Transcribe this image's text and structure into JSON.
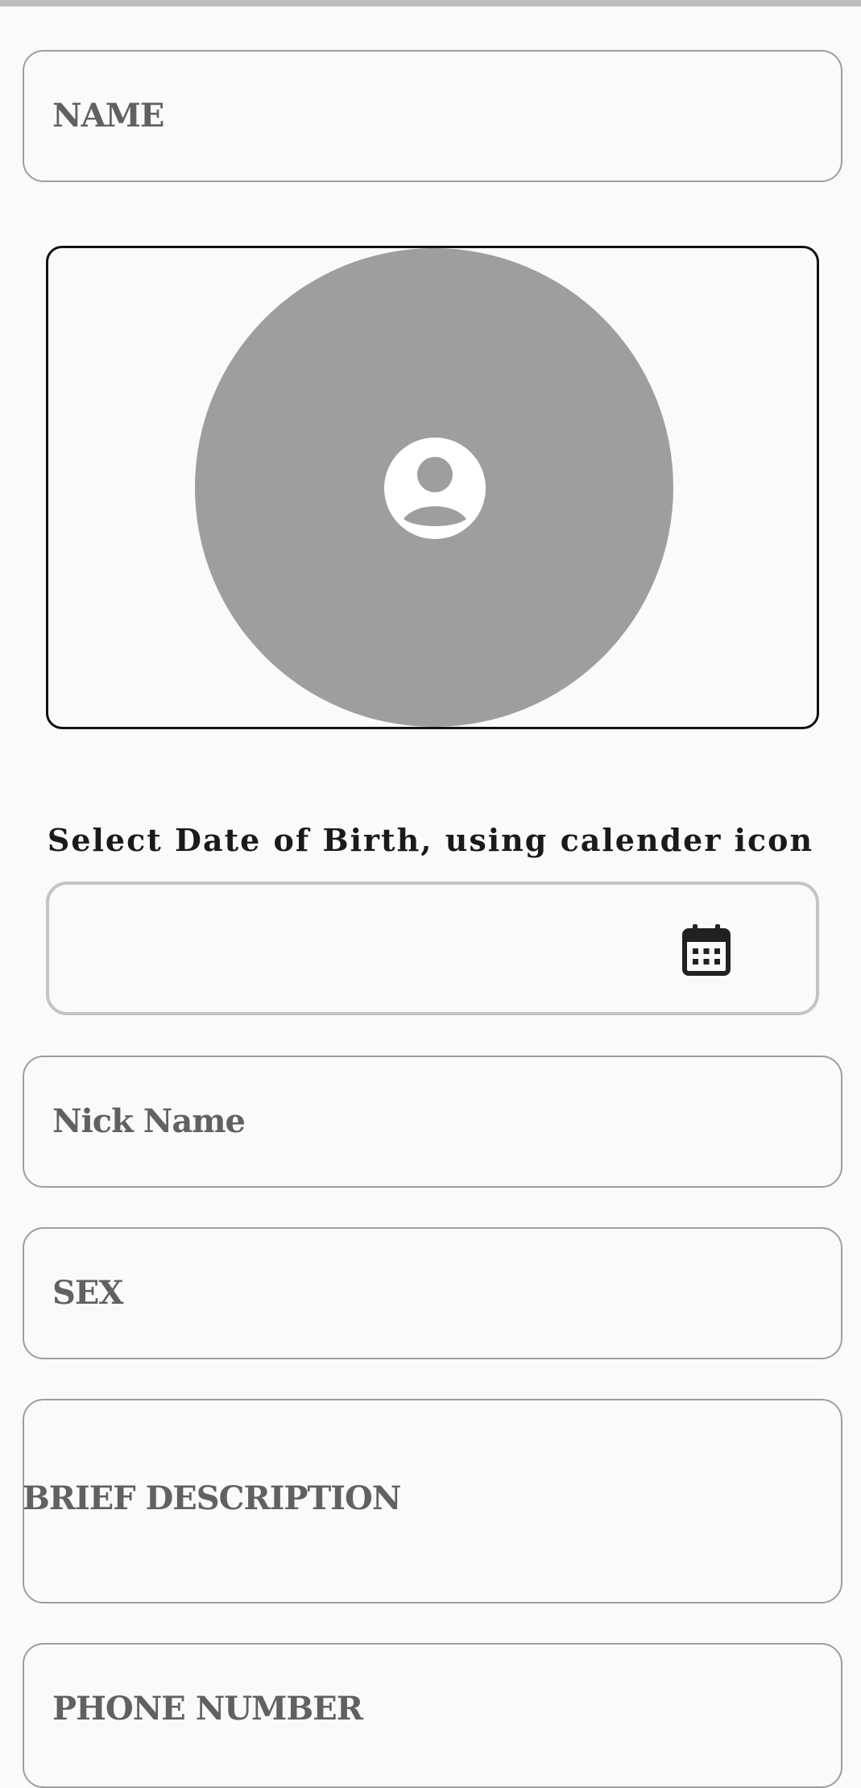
{
  "form": {
    "name_placeholder": "NAME",
    "dob_instruction": "Select Date of Birth, using calender icon",
    "dob_value": "",
    "nickname_placeholder": "Nick Name",
    "sex_placeholder": "SEX",
    "description_placeholder": "BRIEF DESCRIPTION",
    "phone_placeholder": "PHONE NUMBER"
  },
  "photo": {
    "icon": "account-circle-icon",
    "circle_color": "#9e9e9e"
  },
  "dob": {
    "icon": "calendar-icon"
  },
  "colors": {
    "background": "#fafafa",
    "field_border": "#9e9e9e",
    "label_text": "#616161"
  }
}
